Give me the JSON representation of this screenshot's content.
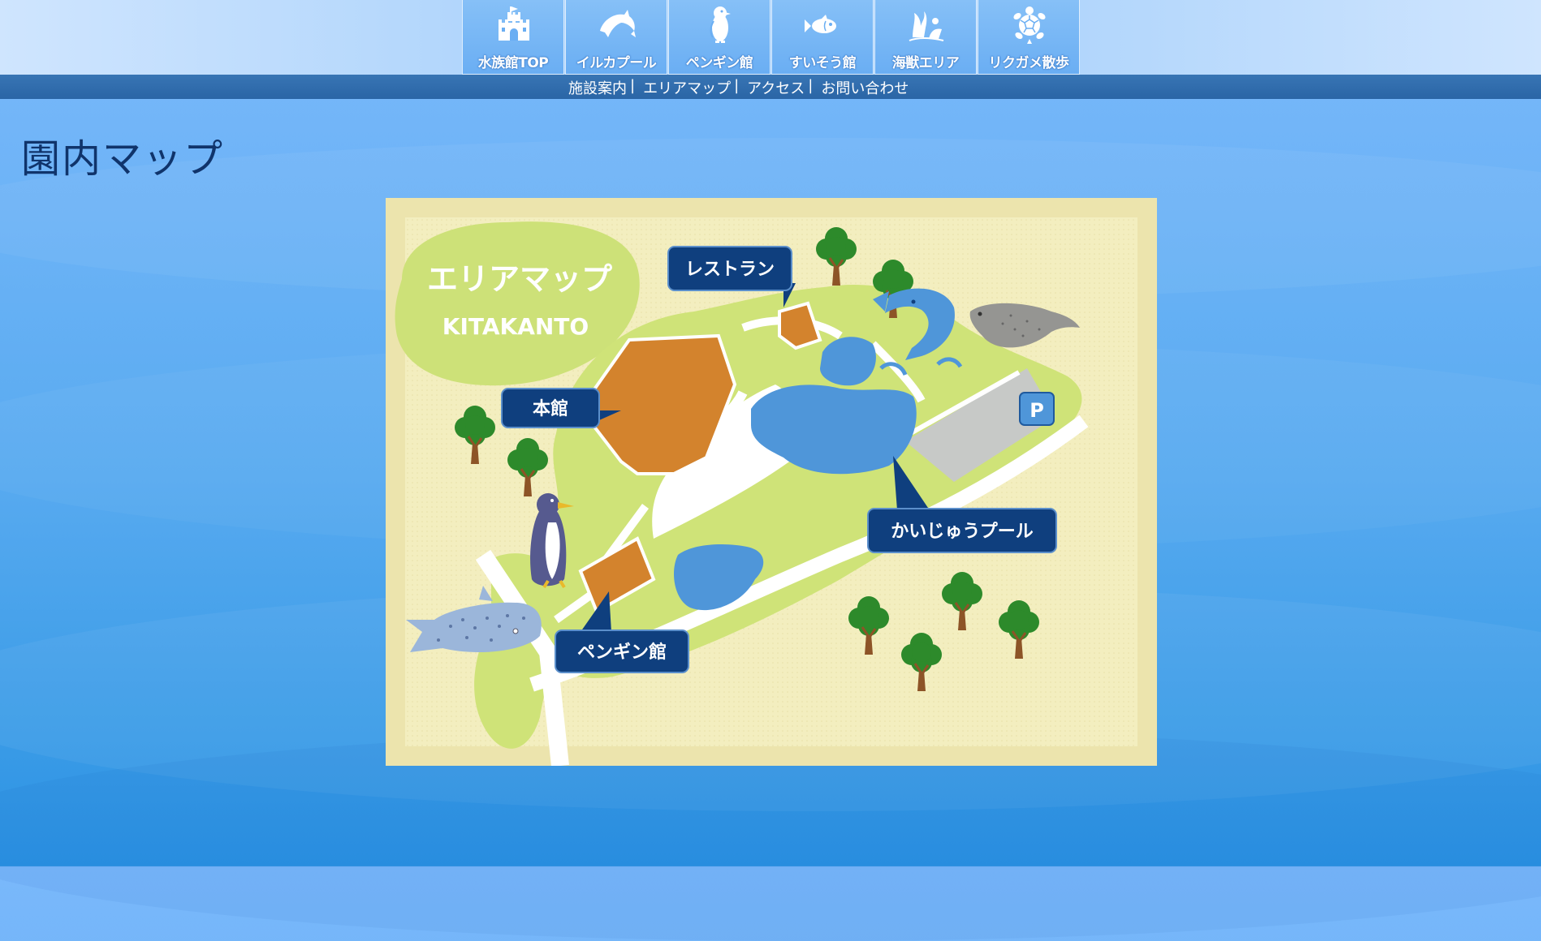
{
  "nav": {
    "items": [
      {
        "label": "水族館TOP",
        "icon": "castle-icon"
      },
      {
        "label": "イルカプール",
        "icon": "dolphin-icon"
      },
      {
        "label": "ペンギン館",
        "icon": "penguin-icon"
      },
      {
        "label": "すいそう館",
        "icon": "fish-icon"
      },
      {
        "label": "海獣エリア",
        "icon": "sea-lion-icon"
      },
      {
        "label": "リクガメ散歩",
        "icon": "turtle-icon"
      }
    ]
  },
  "subnav": {
    "items": [
      "施設案内",
      "エリアマップ",
      "アクセス",
      "お問い合わせ"
    ],
    "separator": "|"
  },
  "page": {
    "title": "園内マップ"
  },
  "map": {
    "title": "エリアマップ",
    "subtitle": "KITAKANTO",
    "labels": {
      "restaurant": "レストラン",
      "main_building": "本館",
      "marine_pool": "かいじゅうプール",
      "penguin_house": "ペンギン館"
    },
    "parking": "P",
    "colors": {
      "paper": "#f2ecbd",
      "grass": "#cee277",
      "building": "#d3832d",
      "water": "#4f96d9",
      "label_bg": "#0f3f7e",
      "parking_lot": "#c7c9c7"
    }
  }
}
